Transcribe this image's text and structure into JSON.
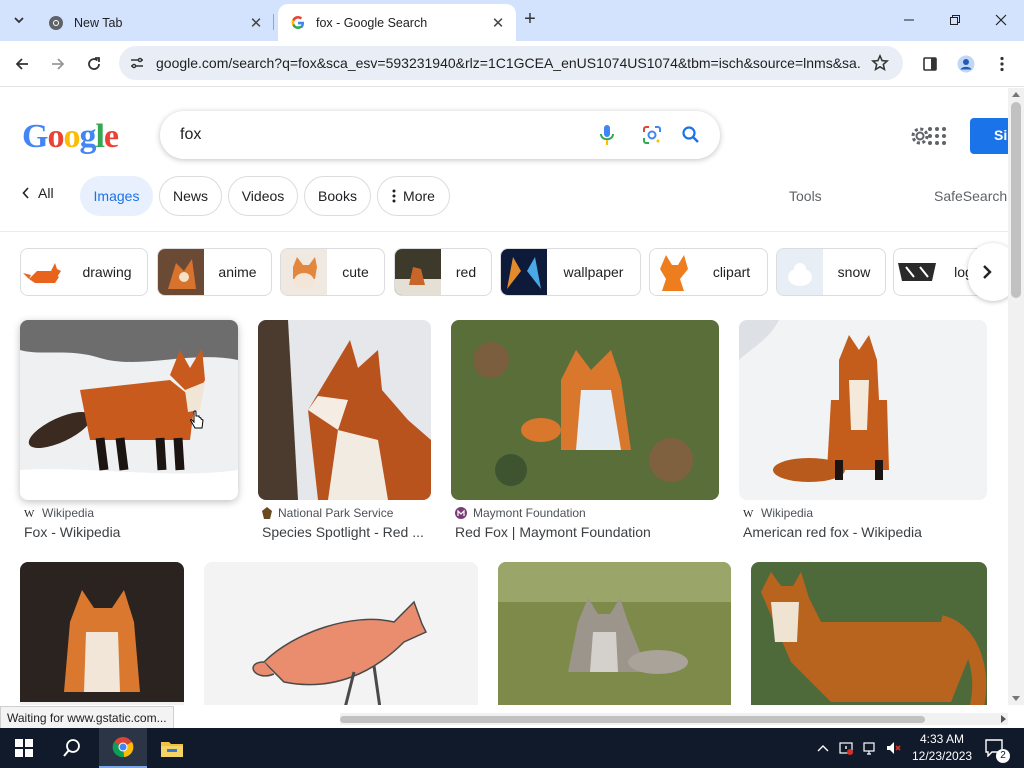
{
  "browser": {
    "tabs": [
      {
        "title": "New Tab",
        "active": false
      },
      {
        "title": "fox - Google Search",
        "active": true
      }
    ],
    "url": "google.com/search?q=fox&sca_esv=593231940&rlz=1C1GCEA_enUS1074US1074&tbm=isch&source=lnms&sa..."
  },
  "search": {
    "query": "fox",
    "sign_in_label": "Si"
  },
  "nav": {
    "back_all": "All",
    "tabs": [
      "Images",
      "News",
      "Videos",
      "Books",
      "More"
    ],
    "tools": "Tools",
    "safesearch": "SafeSearch"
  },
  "chips": [
    "drawing",
    "anime",
    "cute",
    "red",
    "wallpaper",
    "clipart",
    "snow",
    "log"
  ],
  "results": [
    {
      "source": "Wikipedia",
      "caption": "Fox - Wikipedia"
    },
    {
      "source": "National Park Service",
      "caption": "Species Spotlight - Red ..."
    },
    {
      "source": "Maymont Foundation",
      "caption": "Red Fox | Maymont Foundation"
    },
    {
      "source": "Wikipedia",
      "caption": "American red fox - Wikipedia"
    }
  ],
  "status": "Waiting for www.gstatic.com...",
  "taskbar": {
    "time": "4:33 AM",
    "date": "12/23/2023",
    "notifications": "2"
  },
  "colors": {
    "accent": "#1a73e8",
    "tabstrip": "#d3e3fd",
    "taskbar": "#101a2a"
  }
}
